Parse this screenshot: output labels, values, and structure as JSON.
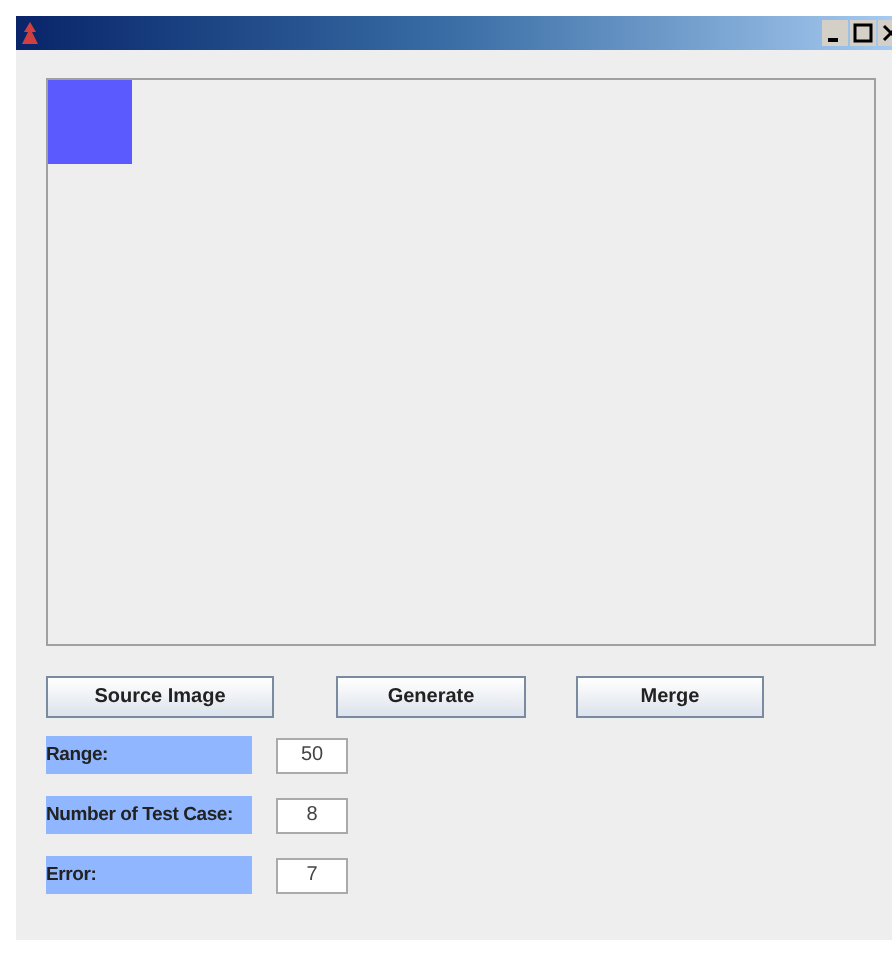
{
  "window": {
    "controls": [
      {
        "kind": "minimize"
      },
      {
        "kind": "maximize"
      },
      {
        "kind": "close"
      }
    ]
  },
  "buttons": [
    "Source Image",
    "Generate",
    "Merge"
  ],
  "fields": [
    {
      "label": "Range:",
      "value": "50"
    },
    {
      "label": "Number of Test Case:",
      "value": "8"
    },
    {
      "label": "Error:",
      "value": "7"
    }
  ]
}
